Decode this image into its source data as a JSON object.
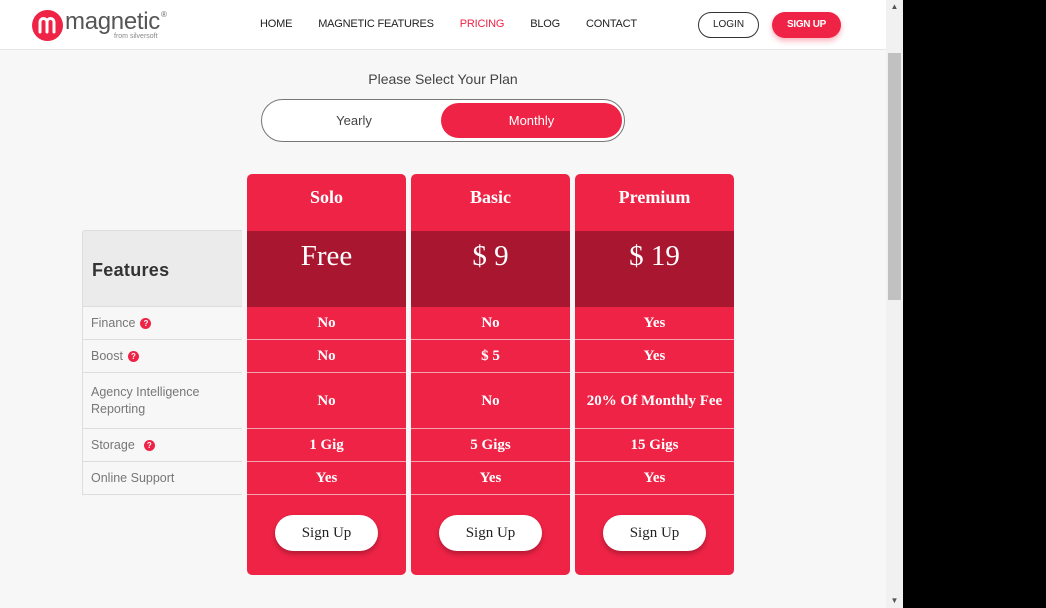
{
  "brand": {
    "name": "magnetic",
    "reg": "®",
    "tagline": "from silversoft",
    "color": "#ee2346"
  },
  "nav": [
    "HOME",
    "MAGNETIC FEATURES",
    "PRICING",
    "BLOG",
    "CONTACT"
  ],
  "nav_active": "PRICING",
  "auth": {
    "login": "LOGIN",
    "signup": "SIGN UP"
  },
  "plan_select": {
    "prompt": "Please Select Your Plan",
    "yearly": "Yearly",
    "monthly": "Monthly",
    "selected": "Monthly"
  },
  "features": {
    "title": "Features",
    "rows": [
      "Finance",
      "Boost",
      "Agency Intelligence Reporting",
      "Storage",
      "Online Support"
    ],
    "help_icon": "question-circle-icon"
  },
  "plans": [
    {
      "name": "Solo",
      "price": "Free",
      "values": [
        "No",
        "No",
        "No",
        "1 Gig",
        "Yes"
      ],
      "cta": "Sign Up"
    },
    {
      "name": "Basic",
      "price": "$ 9",
      "values": [
        "No",
        "$ 5",
        "No",
        "5 Gigs",
        "Yes"
      ],
      "cta": "Sign Up"
    },
    {
      "name": "Premium",
      "price": "$ 19",
      "values": [
        "Yes",
        "Yes",
        "20% Of Monthly Fee",
        "15 Gigs",
        "Yes"
      ],
      "cta": "Sign Up"
    }
  ],
  "colors": {
    "card": "#ee2346",
    "price_band": "#a8172f",
    "feature_head": "#ebebeb"
  }
}
